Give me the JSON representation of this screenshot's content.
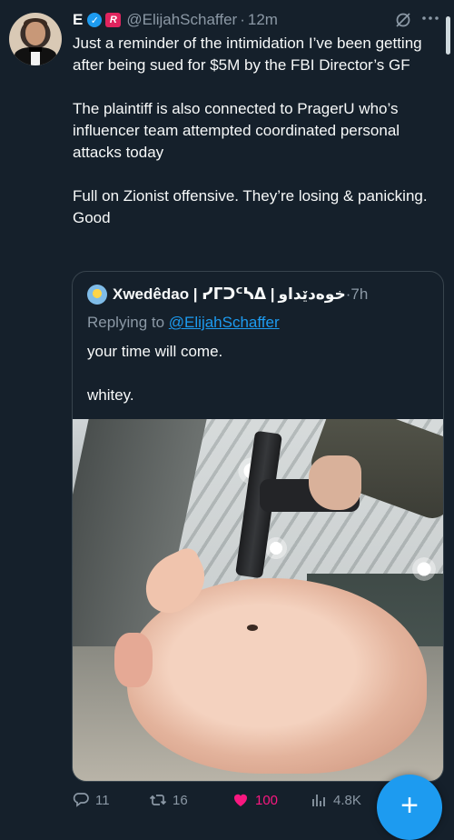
{
  "tweet": {
    "display_name": "E",
    "handle": "@ElijahSchaffer",
    "separator": "·",
    "time": "12m",
    "text": "Just a reminder of the intimidation I’ve been getting after being sued for $5M by the FBI Director’s GF\n\nThe plaintiff is also connected to PragerU who’s influencer team attempted coordinated personal attacks today\n\nFull on Zionist offensive. They’re losing & panicking. Good"
  },
  "quote": {
    "display_name": "Xwedêdao | ᓯᒥᑐᑦᓴᐃ |",
    "display_name_alt": "خوەدێداو",
    "separator": "·",
    "time": "7h",
    "replying_label": "Replying to",
    "replying_handle": "@ElijahSchaffer",
    "text": "your time will come.\n\nwhitey."
  },
  "actions": {
    "replies": "11",
    "reposts": "16",
    "likes": "100",
    "views": "4.8K"
  },
  "fab": {
    "label": "+"
  },
  "icons": {
    "verified": "check-badge-icon",
    "affiliate": "affiliate-badge-icon",
    "grok": "grok-icon",
    "more": "more-icon",
    "reply": "reply-icon",
    "repost": "repost-icon",
    "like": "heart-icon",
    "views": "views-icon"
  },
  "colors": {
    "background": "#15202b",
    "accent": "#1d9bf0",
    "like": "#f91880",
    "muted": "#8b98a5"
  }
}
